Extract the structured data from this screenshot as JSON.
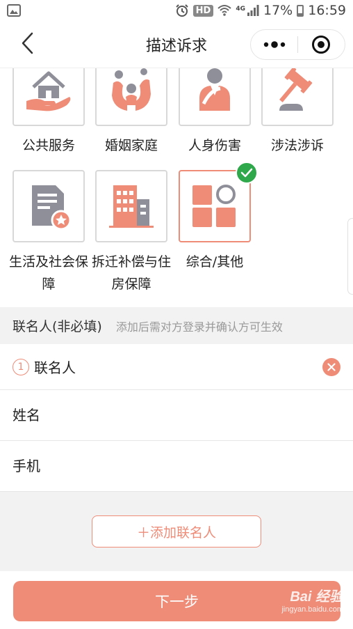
{
  "status_bar": {
    "hd": "HD",
    "network": "4G",
    "battery": "17%",
    "time": "16:59"
  },
  "nav": {
    "title": "描述诉求"
  },
  "categories": [
    {
      "label": "公共服务",
      "icon": "house-hand-icon",
      "selected": false
    },
    {
      "label": "婚姻家庭",
      "icon": "family-icon",
      "selected": false
    },
    {
      "label": "人身伤害",
      "icon": "injured-person-icon",
      "selected": false
    },
    {
      "label": "涉法涉诉",
      "icon": "gavel-icon",
      "selected": false
    },
    {
      "label": "生活及社会保障",
      "icon": "document-badge-icon",
      "selected": false
    },
    {
      "label": "拆迁补偿与住房保障",
      "icon": "buildings-icon",
      "selected": false
    },
    {
      "label": "综合/其他",
      "icon": "grid-shapes-icon",
      "selected": true
    }
  ],
  "contacts": {
    "section_title": "联名人(非必填)",
    "section_hint": "添加后需对方登录并确认方可生效",
    "item_number": "1",
    "item_title": "联名人",
    "name_placeholder": "姓名",
    "phone_placeholder": "手机",
    "add_button": "＋添加联名人"
  },
  "footer": {
    "next_button": "下一步"
  },
  "watermark": {
    "main": "Bai 经验",
    "sub": "jingyan.baidu.com"
  },
  "colors": {
    "accent": "#ee8c78",
    "check": "#2ea84a",
    "icon_gray": "#8f8f99"
  }
}
